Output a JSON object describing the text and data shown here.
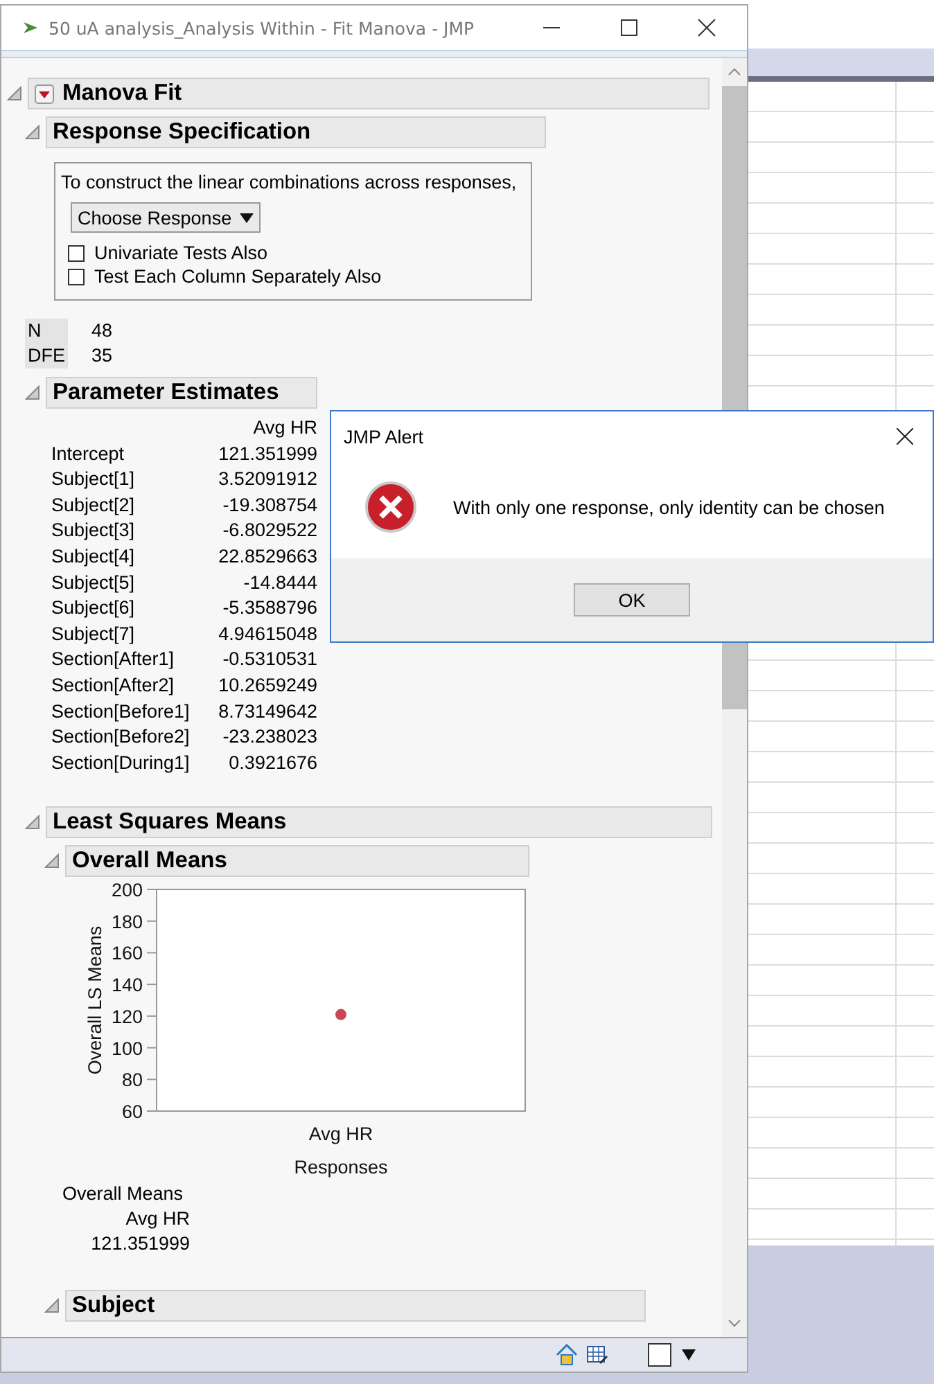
{
  "window": {
    "title": "50 uA analysis_Analysis Within - Fit Manova - JMP"
  },
  "manova_fit": {
    "title": "Manova Fit",
    "response_specification": {
      "title": "Response Specification",
      "instruction": "To construct the linear combinations across responses,",
      "dropdown": "Choose Response",
      "checkboxes": [
        {
          "label": "Univariate Tests Also",
          "checked": false
        },
        {
          "label": "Test Each Column Separately Also",
          "checked": false
        }
      ]
    },
    "summary": [
      {
        "label": "N",
        "value": "48"
      },
      {
        "label": "DFE",
        "value": "35"
      }
    ],
    "parameter_estimates": {
      "title": "Parameter Estimates",
      "column": "Avg HR",
      "rows": [
        {
          "term": "Intercept",
          "estimate": "121.351999"
        },
        {
          "term": "Subject[1]",
          "estimate": "3.52091912"
        },
        {
          "term": "Subject[2]",
          "estimate": "-19.308754"
        },
        {
          "term": "Subject[3]",
          "estimate": "-6.8029522"
        },
        {
          "term": "Subject[4]",
          "estimate": "22.8529663"
        },
        {
          "term": "Subject[5]",
          "estimate": "-14.8444"
        },
        {
          "term": "Subject[6]",
          "estimate": "-5.3588796"
        },
        {
          "term": "Subject[7]",
          "estimate": "4.94615048"
        },
        {
          "term": "Section[After1]",
          "estimate": "-0.5310531"
        },
        {
          "term": "Section[After2]",
          "estimate": "10.2659249"
        },
        {
          "term": "Section[Before1]",
          "estimate": "8.73149642"
        },
        {
          "term": "Section[Before2]",
          "estimate": "-23.238023"
        },
        {
          "term": "Section[During1]",
          "estimate": "0.3921676"
        }
      ]
    },
    "least_squares_means": {
      "title": "Least Squares Means",
      "overall_means": {
        "title": "Overall Means",
        "chart_data": {
          "type": "scatter",
          "xlabel": "Responses",
          "ylabel": "Overall LS Means",
          "categories": [
            "Avg HR"
          ],
          "ylim": [
            60,
            200
          ],
          "yticks": [
            60,
            80,
            100,
            120,
            140,
            160,
            180,
            200
          ],
          "series": [
            {
              "color": "#c8485a",
              "values": [
                121
              ]
            }
          ]
        },
        "table": {
          "title": "Overall Means",
          "column": "Avg HR",
          "value": "121.351999"
        }
      },
      "subject": {
        "title": "Subject"
      }
    }
  },
  "alert": {
    "title": "JMP Alert",
    "message": "With only one response, only identity can be chosen",
    "buttons": [
      "OK"
    ]
  }
}
